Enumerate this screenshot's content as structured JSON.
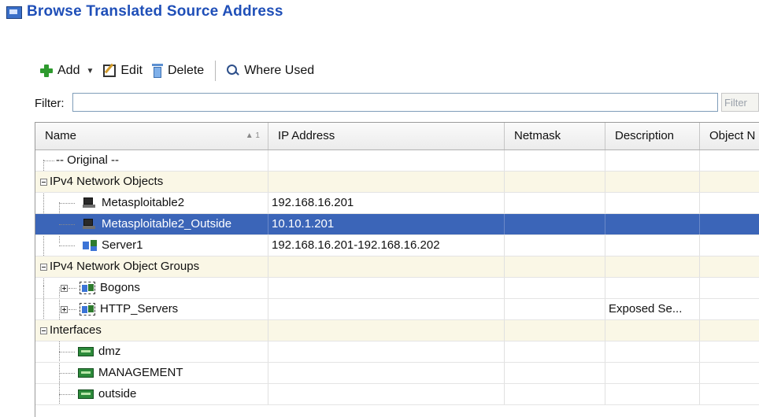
{
  "window": {
    "title": "Browse Translated Source Address"
  },
  "toolbar": {
    "add_label": "Add",
    "edit_label": "Edit",
    "delete_label": "Delete",
    "where_used_label": "Where Used"
  },
  "filter": {
    "label": "Filter:",
    "value": "",
    "button_label": "Filter"
  },
  "table": {
    "columns": [
      "Name",
      "IP Address",
      "Netmask",
      "Description",
      "Object N"
    ],
    "sort_indicator": "▲ 1",
    "rows": [
      {
        "name": "-- Original --",
        "ip": "",
        "netmask": "",
        "description": ""
      },
      {
        "name": "IPv4 Network Objects",
        "ip": "",
        "netmask": "",
        "description": ""
      },
      {
        "name": "Metasploitable2",
        "ip": "192.168.16.201",
        "netmask": "",
        "description": ""
      },
      {
        "name": "Metasploitable2_Outside",
        "ip": "10.10.1.201",
        "netmask": "",
        "description": ""
      },
      {
        "name": "Server1",
        "ip": "192.168.16.201-192.168.16.202",
        "netmask": "",
        "description": ""
      },
      {
        "name": "IPv4 Network Object Groups",
        "ip": "",
        "netmask": "",
        "description": ""
      },
      {
        "name": "Bogons",
        "ip": "",
        "netmask": "",
        "description": ""
      },
      {
        "name": "HTTP_Servers",
        "ip": "",
        "netmask": "",
        "description": "Exposed Se..."
      },
      {
        "name": "Interfaces",
        "ip": "",
        "netmask": "",
        "description": ""
      },
      {
        "name": "dmz",
        "ip": "",
        "netmask": "",
        "description": ""
      },
      {
        "name": "MANAGEMENT",
        "ip": "",
        "netmask": "",
        "description": ""
      },
      {
        "name": "outside",
        "ip": "",
        "netmask": "",
        "description": ""
      }
    ]
  },
  "colors": {
    "accent": "#1f4fb8",
    "selection": "#3b65b8",
    "group_row": "#faf7e6"
  }
}
